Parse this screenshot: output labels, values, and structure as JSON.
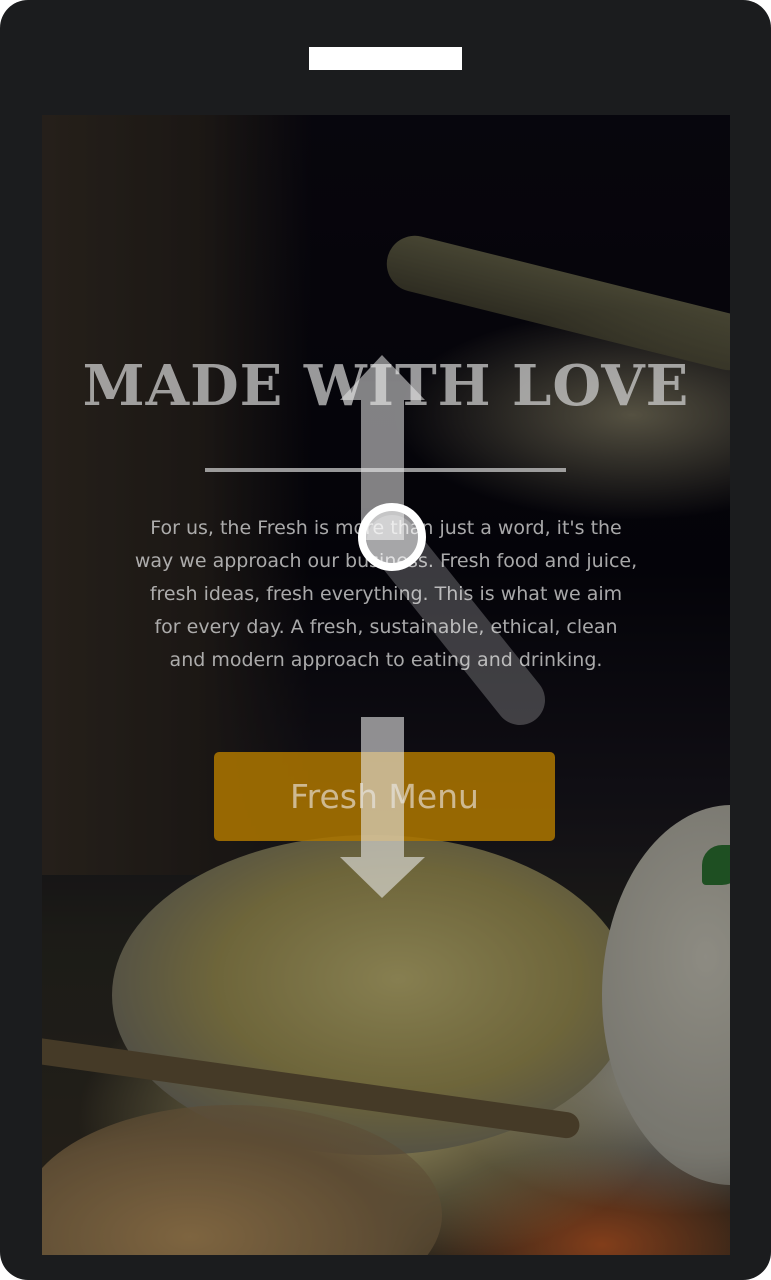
{
  "hero": {
    "headline": "MADE WITH LOVE",
    "intro": "For us, the Fresh is more than just a word, it's the way we approach our business. Fresh food and juice, fresh ideas, fresh everything. This is what we aim for every day. A fresh, sustainable, ethical, clean and modern approach to eating and drinking.",
    "cta_label": "Fresh Menu"
  },
  "gesture": {
    "description_icon": "swipe-up-down-gesture-icon"
  },
  "colors": {
    "device_frame": "#1b1c1e",
    "accent_button": "#aa7400",
    "headline_text": "#d2d2d2"
  }
}
